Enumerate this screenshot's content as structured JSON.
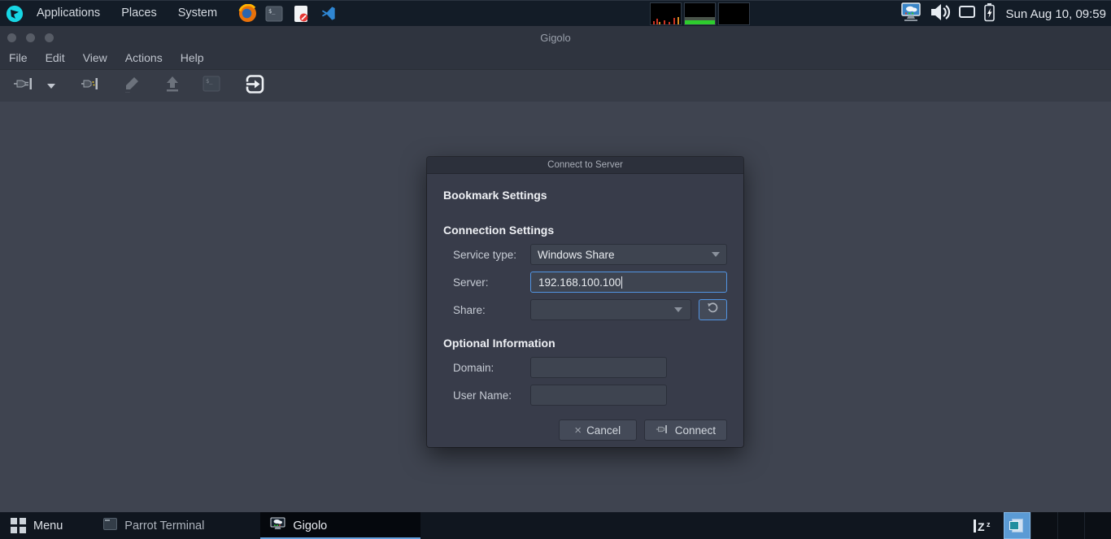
{
  "top_panel": {
    "menus": [
      {
        "label": "Applications"
      },
      {
        "label": "Places"
      },
      {
        "label": "System"
      }
    ],
    "launcher_icons": [
      "parrot-menu-icon",
      "firefox-icon",
      "terminal-icon",
      "text-editor-blocked-icon",
      "vscode-icon"
    ],
    "monitor_applets": [
      "cpu-graph",
      "memory-graph",
      "blank-graph"
    ],
    "tray_icons": [
      "network-icon",
      "volume-icon",
      "display-icon",
      "battery-icon"
    ],
    "clock": "Sun Aug 10, 09:59"
  },
  "window": {
    "title": "Gigolo",
    "menubar": [
      {
        "label": "File"
      },
      {
        "label": "Edit"
      },
      {
        "label": "View"
      },
      {
        "label": "Actions"
      },
      {
        "label": "Help"
      }
    ],
    "toolbar_icons": [
      "connect-icon",
      "connect-dropdown-icon",
      "disconnect-icon",
      "edit-icon",
      "open-icon",
      "terminal-icon",
      "quit-icon"
    ]
  },
  "dialog": {
    "title": "Connect to Server",
    "bookmark_heading": "Bookmark Settings",
    "connection_heading": "Connection Settings",
    "optional_heading": "Optional Information",
    "service_type": {
      "label": "Service type:",
      "value": "Windows Share"
    },
    "server": {
      "label": "Server:",
      "value": "192.168.100.100"
    },
    "share": {
      "label": "Share:",
      "value": ""
    },
    "domain": {
      "label": "Domain:",
      "value": ""
    },
    "user_name": {
      "label": "User Name:",
      "value": ""
    },
    "cancel_label": "Cancel",
    "connect_label": "Connect"
  },
  "taskbar": {
    "menu_label": "Menu",
    "tasks": [
      {
        "label": "Parrot Terminal",
        "active": false
      },
      {
        "label": "Gigolo",
        "active": true
      }
    ],
    "workspace_count": 4,
    "tray_icons": [
      "sleep-zz-icon",
      "workspace-switcher"
    ]
  },
  "colors": {
    "accent": "#5294e2",
    "panel_bg": "#131c27",
    "window_header_bg": "#2f343f",
    "toolbar_bg": "#373c47",
    "content_bg": "#3f4450",
    "dialog_bg": "#383c4a",
    "active_task_underline": "#64a0dc",
    "graph_green": "#2ecc2e",
    "graph_red": "#cc3322"
  }
}
